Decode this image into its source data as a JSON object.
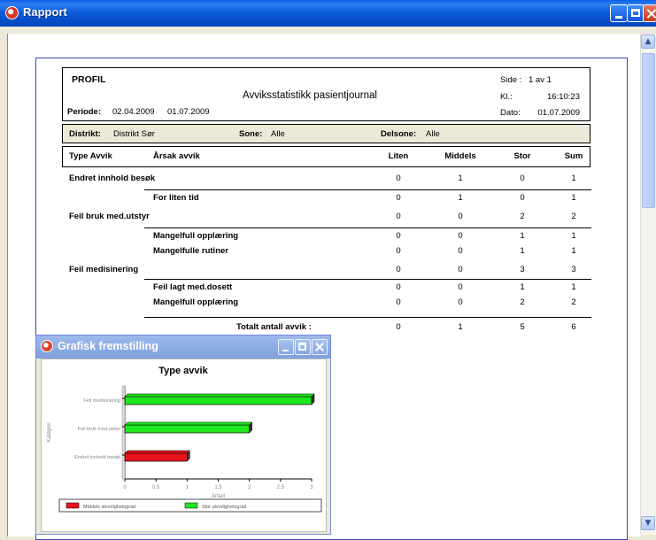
{
  "window": {
    "title": "Rapport"
  },
  "report": {
    "profile": "PROFIL",
    "title": "Avviksstatistikk pasientjournal",
    "period_label": "Periode:",
    "period_from": "02.04.2009",
    "period_to": "01.07.2009",
    "side_label": "Side :",
    "side_value": "1 av 1",
    "kl_label": "Kl.:",
    "kl_value": "16:10:23",
    "dato_label": "Dato:",
    "dato_value": "01.07.2009",
    "distrikt_label": "Distrikt:",
    "distrikt_value": "Distrikt Sør",
    "sone_label": "Sone:",
    "sone_value": "Alle",
    "delsone_label": "Delsone:",
    "delsone_value": "Alle",
    "columns": [
      "Type Avvik",
      "Årsak avvik",
      "Liten",
      "Middels",
      "Stor",
      "Sum"
    ],
    "rows": [
      {
        "label": "Endret innhold besøk",
        "indent": false,
        "liten": "0",
        "middels": "1",
        "stor": "0",
        "sum": "1"
      },
      {
        "label": "For liten tid",
        "indent": true,
        "liten": "0",
        "middels": "1",
        "stor": "0",
        "sum": "1"
      },
      {
        "label": "Feil bruk med.utstyr",
        "indent": false,
        "liten": "0",
        "middels": "0",
        "stor": "2",
        "sum": "2"
      },
      {
        "label": "Mangelfull opplæring",
        "indent": true,
        "liten": "0",
        "middels": "0",
        "stor": "1",
        "sum": "1"
      },
      {
        "label": "Mangelfulle rutiner",
        "indent": true,
        "liten": "0",
        "middels": "0",
        "stor": "1",
        "sum": "1"
      },
      {
        "label": "Feil medisinering",
        "indent": false,
        "liten": "0",
        "middels": "0",
        "stor": "3",
        "sum": "3"
      },
      {
        "label": "Feil lagt med.dosett",
        "indent": true,
        "liten": "0",
        "middels": "0",
        "stor": "1",
        "sum": "1"
      },
      {
        "label": "Mangelfull opplæring",
        "indent": true,
        "liten": "0",
        "middels": "0",
        "stor": "2",
        "sum": "2"
      }
    ],
    "total_label": "Totalt antall avvik :",
    "total": {
      "liten": "0",
      "middels": "1",
      "stor": "5",
      "sum": "6"
    }
  },
  "chart_window": {
    "title": "Grafisk fremstilling"
  },
  "chart_data": {
    "type": "bar",
    "orientation": "horizontal",
    "stacked": true,
    "title": "Type avvik",
    "xlabel": "Antall",
    "ylabel": "Kategori",
    "categories": [
      "Feil medisinering",
      "Feil bruk med.utstyr",
      "Endret innhold besøk"
    ],
    "series": [
      {
        "name": "Middels alvorlighetsgrad",
        "color": "#e8141b",
        "values": [
          0,
          0,
          1
        ]
      },
      {
        "name": "Stor alvorlighetsgrad",
        "color": "#1ee61e",
        "values": [
          3,
          2,
          0
        ]
      }
    ],
    "xlim": [
      0,
      3
    ],
    "xticks": [
      "0",
      "0.5",
      "1",
      "1.5",
      "2",
      "2.5",
      "3"
    ],
    "legend": "bottom"
  }
}
